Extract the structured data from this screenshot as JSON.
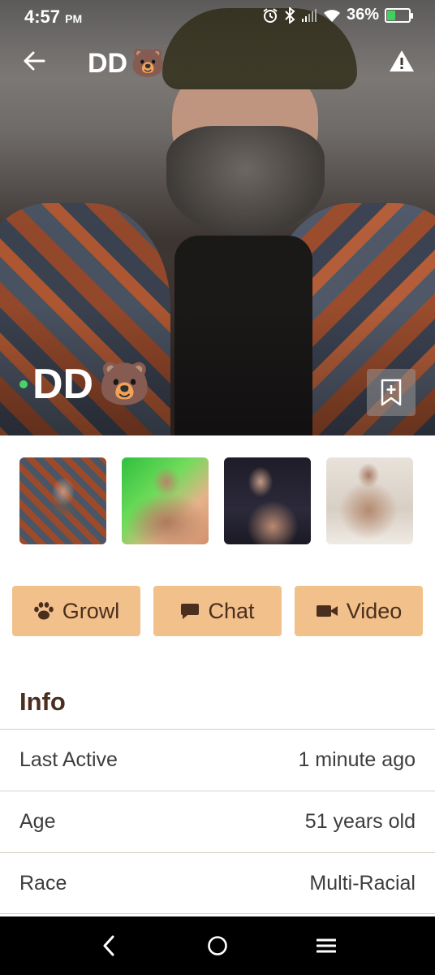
{
  "status_bar": {
    "time": "4:57",
    "ampm": "PM",
    "battery": "36%",
    "battery_level": 0.36,
    "icons": [
      "alarm-icon",
      "bluetooth-icon",
      "signal-icon",
      "wifi-icon",
      "battery-icon"
    ]
  },
  "header": {
    "title": "DD",
    "title_emoji": "🐻",
    "icons": [
      "back-arrow-icon",
      "warning-icon"
    ]
  },
  "profile": {
    "name": "DD",
    "name_emoji": "🐻",
    "online": true,
    "online_color": "#4ad36a",
    "photo_count": 4
  },
  "actions": [
    {
      "label": "Growl",
      "icon": "paw-icon"
    },
    {
      "label": "Chat",
      "icon": "speech-bubble-icon"
    },
    {
      "label": "Video",
      "icon": "video-camera-icon"
    }
  ],
  "info": {
    "title": "Info",
    "rows": [
      {
        "label": "Last Active",
        "value": "1 minute ago"
      },
      {
        "label": "Age",
        "value": "51 years old"
      },
      {
        "label": "Race",
        "value": "Multi-Racial"
      }
    ]
  },
  "colors": {
    "accent": "#f2c08a",
    "text_brown": "#4a2f1e"
  },
  "nav": {
    "icons": [
      "nav-back-icon",
      "nav-home-icon",
      "nav-recents-icon"
    ]
  }
}
